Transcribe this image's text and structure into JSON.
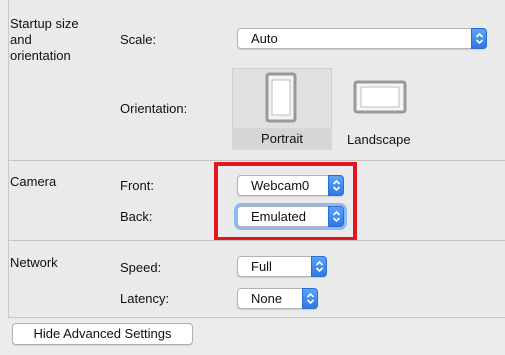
{
  "startup": {
    "title": "Startup size\nand\norientation",
    "scale_label": "Scale:",
    "scale_value": "Auto",
    "orientation_label": "Orientation:",
    "portrait_label": "Portrait",
    "landscape_label": "Landscape",
    "selected_orientation": "Portrait"
  },
  "camera": {
    "title": "Camera",
    "front_label": "Front:",
    "front_value": "Webcam0",
    "back_label": "Back:",
    "back_value": "Emulated",
    "highlight_color": "#e2161c"
  },
  "network": {
    "title": "Network",
    "speed_label": "Speed:",
    "speed_value": "Full",
    "latency_label": "Latency:",
    "latency_value": "None"
  },
  "footer": {
    "hide_advanced_label": "Hide Advanced Settings"
  },
  "colors": {
    "accent": "#3a87ee",
    "background": "#ececec"
  }
}
